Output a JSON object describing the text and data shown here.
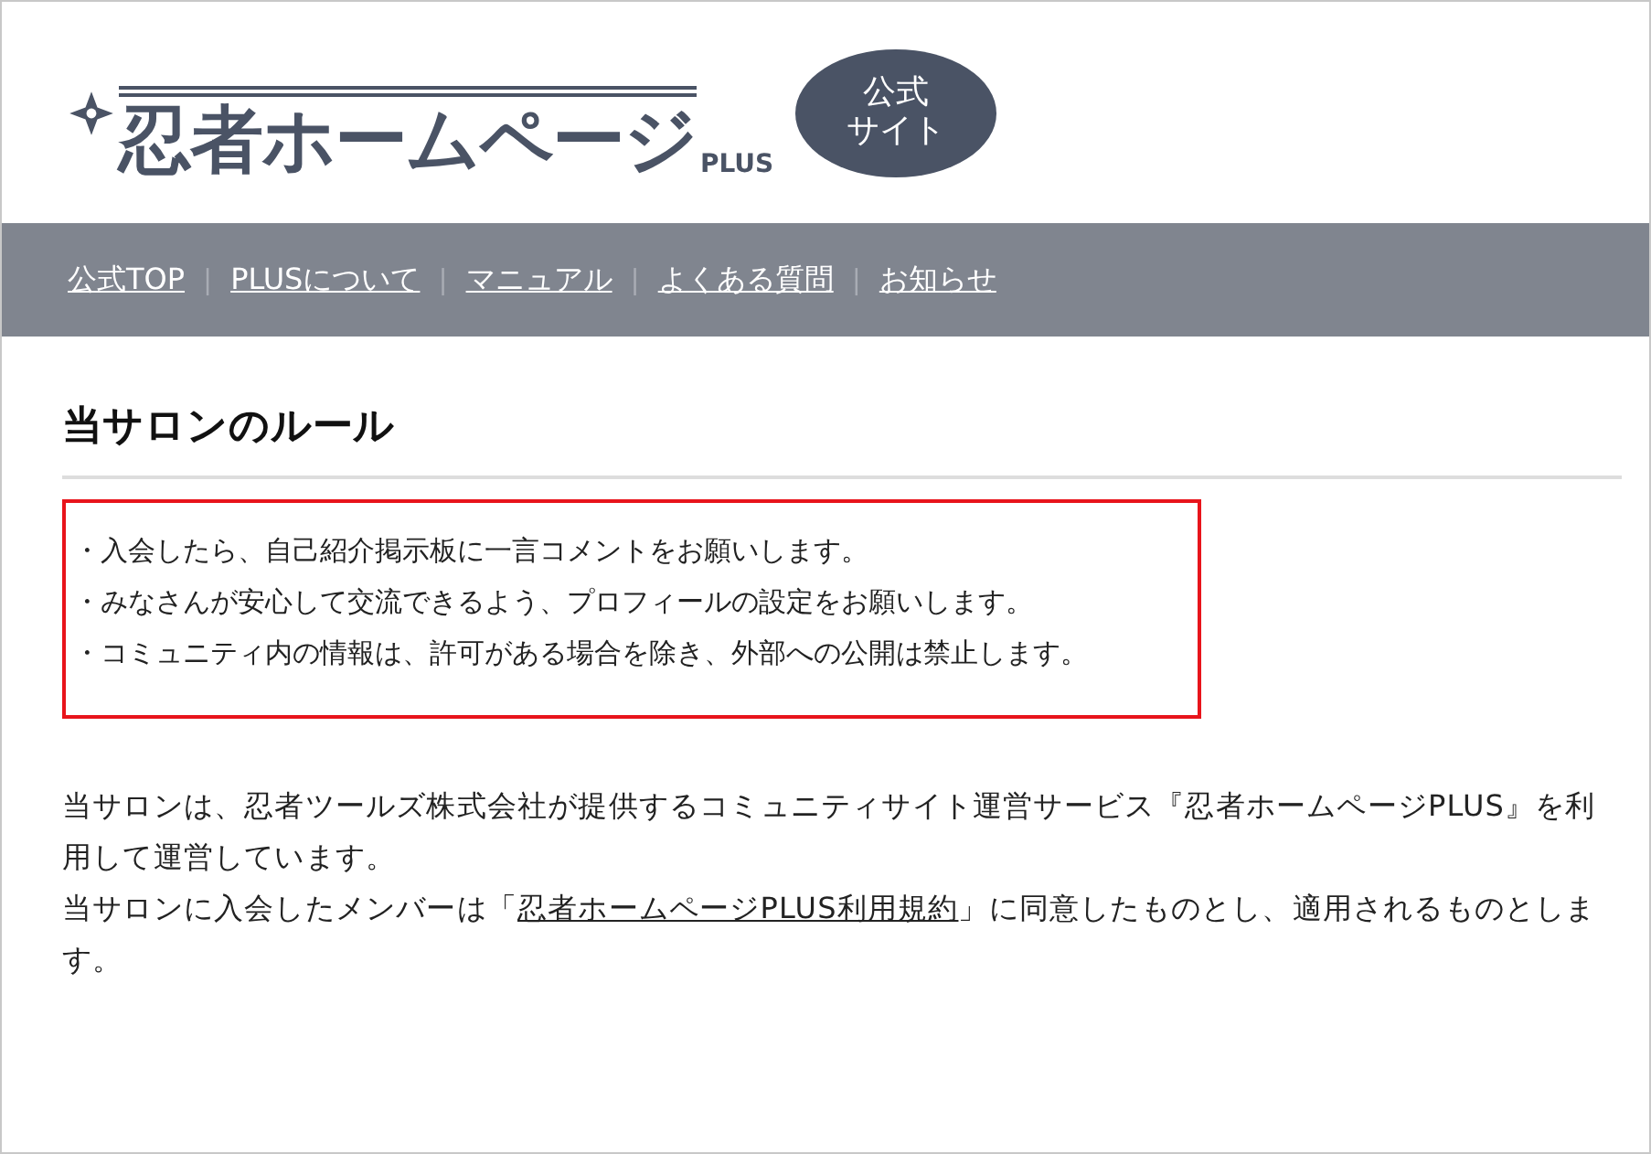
{
  "logo": {
    "title": "忍者ホームページ",
    "badge": "PLUS",
    "bubble_lines": [
      "公式",
      "サイト"
    ]
  },
  "nav": {
    "items": [
      {
        "kind": "link",
        "label": "公式TOP"
      },
      {
        "kind": "separator",
        "label": "|"
      },
      {
        "kind": "link",
        "label": "PLUSについて"
      },
      {
        "kind": "separator",
        "label": "|"
      },
      {
        "kind": "link",
        "label": "マニュアル"
      },
      {
        "kind": "separator",
        "label": "|"
      },
      {
        "kind": "link",
        "label": "よくある質問"
      },
      {
        "kind": "separator",
        "label": "|"
      },
      {
        "kind": "link",
        "label": "お知らせ"
      }
    ]
  },
  "heading": "当サロンのルール",
  "rules": [
    "・入会したら、自己紹介掲示板に一言コメントをお願いします。",
    "・みなさんが安心して交流できるよう、プロフィールの設定をお願いします。",
    "・コミュニティ内の情報は、許可がある場合を除き、外部への公開は禁止します。"
  ],
  "about": [
    {
      "parts": [
        {
          "kind": "text",
          "text": "当サロンは、忍者ツールズ株式会社が提供するコミュニティサイト運営サービス『忍者ホームページPLUS』を利用して運営しています。"
        }
      ]
    },
    {
      "parts": [
        {
          "kind": "text",
          "text": "当サロンに入会したメンバーは「"
        },
        {
          "kind": "link",
          "text": "忍者ホームページPLUS利用規約"
        },
        {
          "kind": "text",
          "text": "」に同意したものとし、適用されるものとします。"
        }
      ]
    }
  ]
}
